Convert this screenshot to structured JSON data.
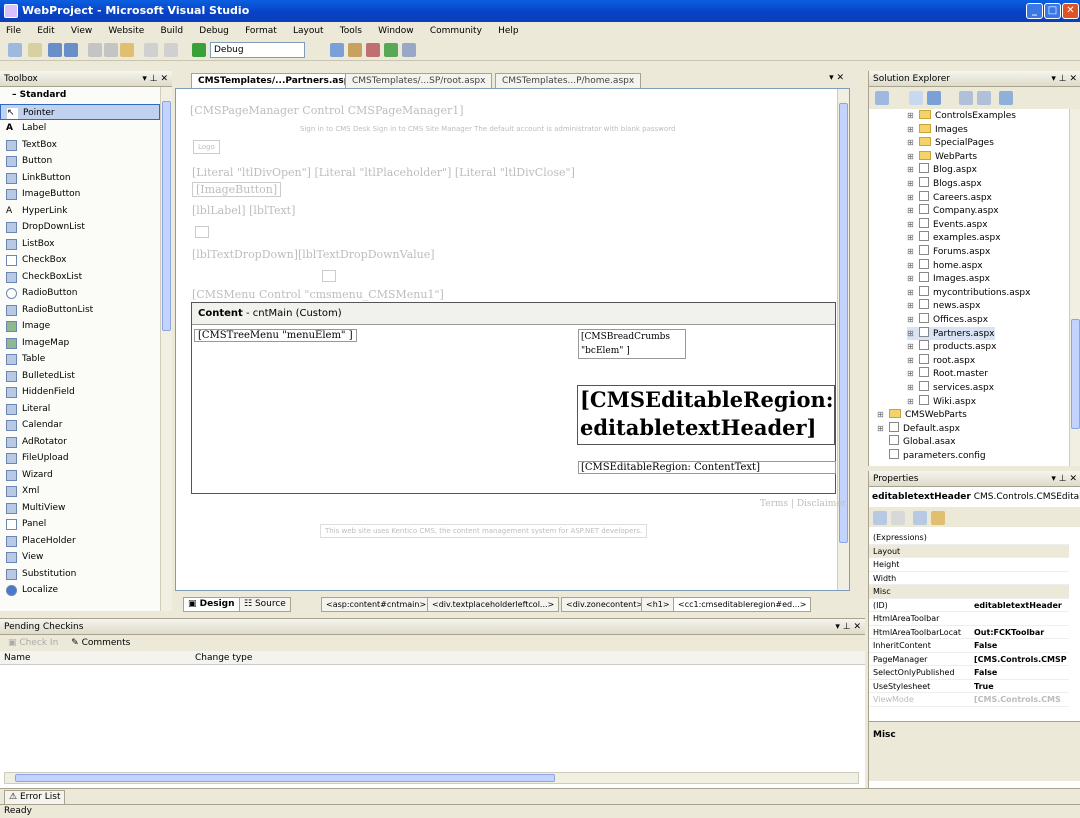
{
  "window": {
    "title": "WebProject - Microsoft Visual Studio"
  },
  "menu": [
    "File",
    "Edit",
    "View",
    "Website",
    "Build",
    "Debug",
    "Format",
    "Layout",
    "Tools",
    "Window",
    "Community",
    "Help"
  ],
  "toolbar": {
    "config": "Debug"
  },
  "toolbox": {
    "title": "Toolbox",
    "category": "Standard",
    "items": [
      "Pointer",
      "Label",
      "TextBox",
      "Button",
      "LinkButton",
      "ImageButton",
      "HyperLink",
      "DropDownList",
      "ListBox",
      "CheckBox",
      "CheckBoxList",
      "RadioButton",
      "RadioButtonList",
      "Image",
      "ImageMap",
      "Table",
      "BulletedList",
      "HiddenField",
      "Literal",
      "Calendar",
      "AdRotator",
      "FileUpload",
      "Wizard",
      "Xml",
      "MultiView",
      "Panel",
      "PlaceHolder",
      "View",
      "Substitution",
      "Localize"
    ]
  },
  "tabs": [
    "CMSTemplates/...Partners.aspx",
    "CMSTemplates/...SP/root.aspx",
    "CMSTemplates...P/home.aspx"
  ],
  "designer": {
    "pagemanager": "[CMSPageManager Control CMSPageManager1]",
    "faint_line": "Sign in to CMS Desk  Sign in to CMS Site Manager  The default account is administrator with blank password",
    "logo": "Logo",
    "literals": "[Literal \"ltlDivOpen\"] [Literal \"ltlPlaceholder\"] [Literal \"ltlDivClose\"]",
    "imgbtn": "[ImageButton]",
    "labels": "[lblLabel] [lblText]",
    "dropdown": "[lblTextDropDown][lblTextDropDownValue]",
    "cmsmenu": "[CMSMenu Control \"cmsmenu_CMSMenu1\"]",
    "content_header": "Content",
    "content_region": "- cntMain (Custom)",
    "treemenu": "[CMSTreeMenu \"menuElem\" ]",
    "breadcrumbs": "[CMSBreadCrumbs \"bcElem\" ]",
    "header_region_1": "[CMSEditableRegion:",
    "header_region_2": "editabletextHeader]",
    "content_text": "[CMSEditableRegion: ContentText]",
    "footer_link": "Terms | Disclaimer",
    "footer_note": "This web site uses Kentico CMS, the content management system for ASP.NET developers."
  },
  "bottom_tabs": {
    "design": "Design",
    "source": "Source"
  },
  "tag_path": [
    "<asp:content#cntmain>",
    "<div.textplaceholderleftcol...>",
    "<div.zonecontent>",
    "<h1>",
    "<cc1:cmseditableregion#ed...>"
  ],
  "pending": {
    "title": "Pending Checkins",
    "comments": "Comments",
    "col_name": "Name",
    "col_change": "Change type"
  },
  "solution": {
    "title": "Solution Explorer",
    "folders": [
      "ControlsExamples",
      "Images",
      "SpecialPages",
      "WebParts"
    ],
    "files": [
      "Blog.aspx",
      "Blogs.aspx",
      "Careers.aspx",
      "Company.aspx",
      "Events.aspx",
      "examples.aspx",
      "Forums.aspx",
      "home.aspx",
      "Images.aspx",
      "mycontributions.aspx",
      "news.aspx",
      "Offices.aspx",
      "Partners.aspx",
      "products.aspx",
      "root.aspx",
      "Root.master",
      "services.aspx",
      "Wiki.aspx"
    ],
    "root_items": [
      "CMSWebParts",
      "Default.aspx",
      "Global.asax",
      "parameters.config"
    ]
  },
  "properties": {
    "title": "Properties",
    "object": "editabletextHeader",
    "object_type": "CMS.Controls.CMSEditab",
    "rows": [
      {
        "name": "(Expressions)",
        "value": ""
      },
      {
        "name": "Layout",
        "value": "",
        "cat": true
      },
      {
        "name": "Height",
        "value": ""
      },
      {
        "name": "Width",
        "value": ""
      },
      {
        "name": "Misc",
        "value": "",
        "cat": true
      },
      {
        "name": "(ID)",
        "value": "editabletextHeader"
      },
      {
        "name": "HtmlAreaToolbar",
        "value": ""
      },
      {
        "name": "HtmlAreaToolbarLocat",
        "value": "Out:FCKToolbar"
      },
      {
        "name": "InheritContent",
        "value": "False"
      },
      {
        "name": "PageManager",
        "value": "[CMS.Controls.CMSP"
      },
      {
        "name": "SelectOnlyPublished",
        "value": "False"
      },
      {
        "name": "UseStylesheet",
        "value": "True"
      },
      {
        "name": "ViewMode",
        "value": "[CMS.Controls.CMS"
      }
    ],
    "desc_title": "Misc"
  },
  "error_tab": "Error List",
  "status": "Ready"
}
